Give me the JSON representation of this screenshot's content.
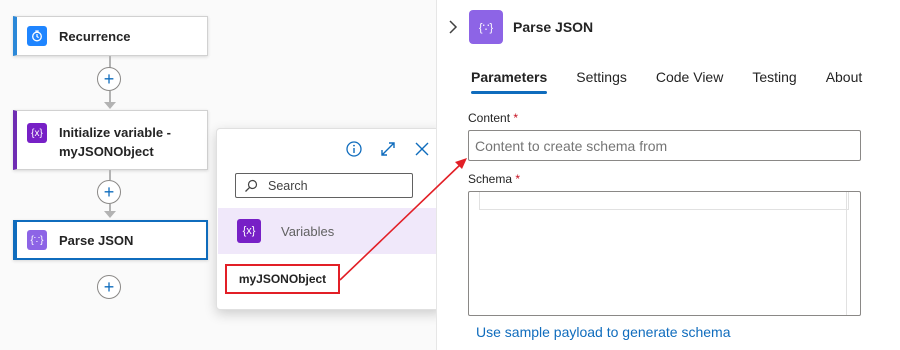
{
  "flow": {
    "recurrence": {
      "title": "Recurrence",
      "icon": "clock-icon"
    },
    "init_variable": {
      "title_line1": "Initialize variable -",
      "title_line2": "myJSONObject",
      "icon": "variable-icon"
    },
    "parse_json": {
      "title": "Parse JSON",
      "icon": "parse-json-icon"
    },
    "add_glyph": "+"
  },
  "popup": {
    "search_placeholder": "Search",
    "section_label": "Variables",
    "token": "myJSONObject",
    "variable_glyph": "{x}"
  },
  "panel": {
    "title": "Parse JSON",
    "action_glyph": "{∵}",
    "tabs": [
      "Parameters",
      "Settings",
      "Code View",
      "Testing",
      "About"
    ],
    "active_tab": "Parameters",
    "content_label": "Content",
    "content_placeholder": "Content to create schema from",
    "schema_label": "Schema",
    "required_mark": "*",
    "sample_link": "Use sample payload to generate schema"
  },
  "colors": {
    "accent": "#0f6cbd",
    "variable_purple": "#7720c6",
    "parse_purple": "#8d64e6",
    "annotation_red": "#e21f26"
  }
}
